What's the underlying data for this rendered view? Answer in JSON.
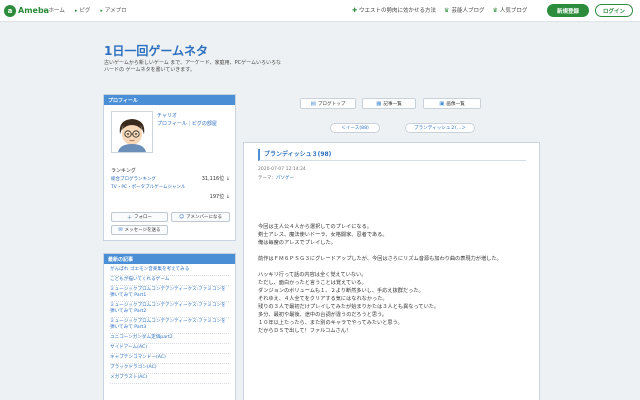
{
  "header": {
    "logo_text": "Ameba",
    "nav": [
      "ホーム",
      "ピグ",
      "アメプロ"
    ],
    "links": [
      {
        "icon": "plus-icon",
        "label": "ウエストの勢肉に効かせる方法"
      },
      {
        "icon": "crown-icon",
        "label": "芸能人ブログ"
      },
      {
        "icon": "crown-icon",
        "label": "人気ブログ"
      }
    ],
    "register_label": "新規登録",
    "login_label": "ログイン"
  },
  "blog": {
    "title": "1日一回ゲームネタ",
    "description": "古いゲームから新しいゲーム まで、アーケード、家庭用、PCゲームいろいろなハードの ゲームネタを書いていきます。"
  },
  "profile": {
    "heading": "プロフィール",
    "name": "チャリオ",
    "links": "プロフィール｜ピグの部屋",
    "ranking_label": "ランキング",
    "ranks": [
      {
        "label": "総合ブログランキング",
        "value": "31,116位 ↓"
      },
      {
        "label": "TV・PC・ポータブルゲームジャンル",
        "value": "197位 ↓"
      }
    ],
    "follow_label": "フォロー",
    "amember_label": "アメンバーになる",
    "message_label": "メッセージを送る"
  },
  "recent": {
    "heading": "最新の記事",
    "items": [
      "がんばれ ゴエモン音楽集を考えてみる",
      "こどもが描いてくれるゲーム",
      "ミュージックプロムコンテアンティークス:ファミコンを弾いてみて Part1",
      "ミュージックプロムコンテアンティークス:ファミコンを弾いてみて Part2",
      "ミュージックプロムコンテアンティークス:ファミコンを弾いてみて Part3",
      "ユニコーンガンダム定価part2",
      "サイドアーム(AC)",
      "キャプテンコマンドー(AC)",
      "ブラックドラゴン(AC)",
      "メガブラスト(AC)"
    ]
  },
  "tabs": [
    {
      "icon": "book-icon",
      "label": "ブログトップ"
    },
    {
      "icon": "list-icon",
      "label": "記事一覧"
    },
    {
      "icon": "image-icon",
      "label": "画像一覧"
    }
  ],
  "pager": {
    "prev": "＜イース(88)",
    "next": "ブランディッシュ２(…＞"
  },
  "article": {
    "title": "ブランディッシュ３(98)",
    "date": "2020-07-07 12:14:24",
    "theme_label": "テーマ：",
    "theme": "パソゲー",
    "paragraphs": [
      "今回は主人公４人から選択してのプレイになる。\n剣士アレス、魔法使いドーラ、女格闘家、忍者である。\n俺は毎度のアレスでプレイした。",
      "前作はＦＭ６ＰＳＧ３にグレードアップしたが、今回はさらにリズム音源も加わり曲の表現力が増した。",
      "ハッキリ行って話の内容は全く覚えていない。\nただし、面白かったと言うことは覚えている。\nダンジョンのボリュームも１、２より断然多いし、手応え抜群だった。\nそれゆえ、４人全てをクリアする気にはなれなかった。\n残りの３人で最初だけプレイしてみたが始まりかたは３人とも異なっていた。\n多分、最初や最後、途中の台詞が違うのだろうと思う。\n１０年以上たったら、また別のキャラでやってみたいと思う。\nだからＤＳで出して！ファルコムさん！"
    ]
  }
}
